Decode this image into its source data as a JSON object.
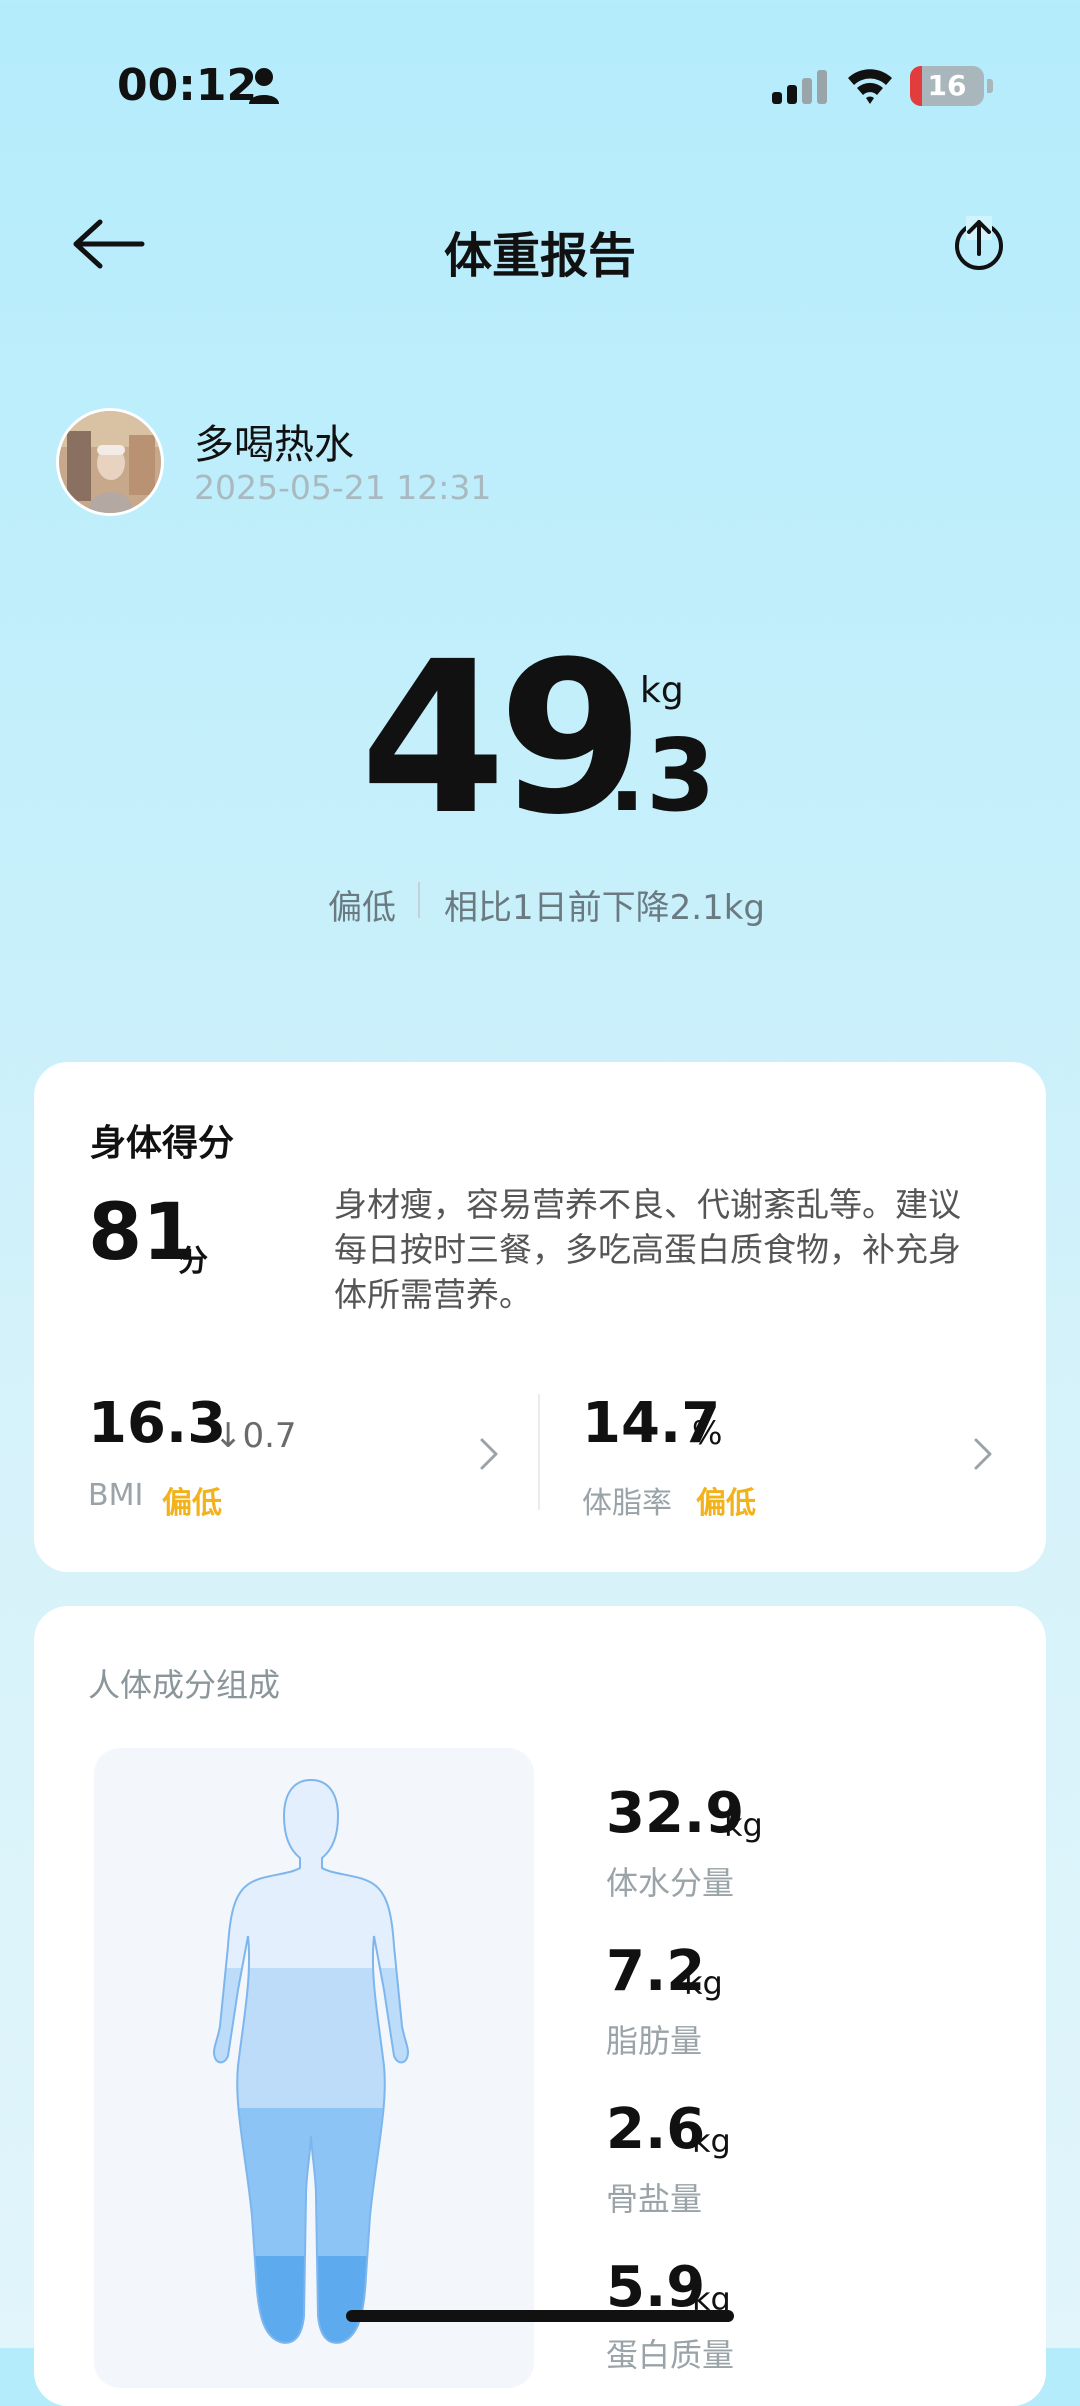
{
  "status_bar": {
    "time": "00:12",
    "battery": "16",
    "person_icon": "person-icon",
    "signal_icon": "signal-icon",
    "wifi_icon": "wifi-icon"
  },
  "header": {
    "title": "体重报告",
    "back_icon": "arrow-left-icon",
    "share_icon": "share-icon"
  },
  "user": {
    "name": "多喝热水",
    "datetime": "2025-05-21 12:31"
  },
  "weight": {
    "integer": "49",
    "decimal": ".3",
    "unit": "kg",
    "status": "偏低",
    "change": "相比1日前下降2.1kg"
  },
  "score_card": {
    "label": "身体得分",
    "value": "81",
    "unit": "分",
    "description": "身材瘦，容易营养不良、代谢紊乱等。建议每日按时三餐，多吃高蛋白质食物，补充身体所需营养。",
    "bmi": {
      "value": "16.3",
      "change": "↓0.7",
      "label": "BMI",
      "status": "偏低"
    },
    "body_fat": {
      "value": "14.7",
      "unit": "%",
      "label": "体脂率",
      "status": "偏低"
    }
  },
  "composition": {
    "title": "人体成分组成",
    "items": [
      {
        "value": "32.9",
        "unit": "kg",
        "label": "体水分量"
      },
      {
        "value": "7.2",
        "unit": "kg",
        "label": "脂肪量"
      },
      {
        "value": "2.6",
        "unit": "kg",
        "label": "骨盐量"
      },
      {
        "value": "5.9",
        "unit": "kg",
        "label": "蛋白质量"
      }
    ]
  },
  "colors": {
    "accent_status": "#f2b21b",
    "background_top": "#b4ecfb",
    "body_fill_light": "#e2effd",
    "body_fill_mid": "#b9daf9",
    "body_fill_dark": "#62aef0"
  }
}
